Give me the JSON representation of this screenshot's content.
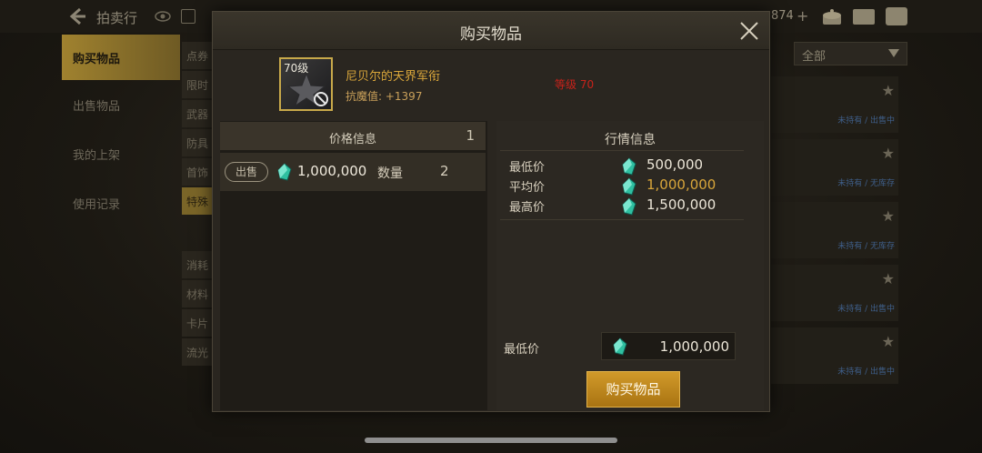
{
  "background": {
    "title": "拍卖行",
    "currency": "874",
    "nav_items": [
      "购买物品",
      "出售物品",
      "我的上架",
      "使用记录"
    ],
    "sub_nav_items": [
      "点券",
      "限时",
      "武器",
      "防具",
      "首饰",
      "特殊",
      "消耗",
      "材料",
      "卡片",
      "流光"
    ],
    "filter_value": "全部",
    "row_status": [
      "未持有 / 出售中",
      "未持有 / 无库存",
      "未持有 / 无库存",
      "未持有 / 出售中",
      "未持有 / 出售中",
      ""
    ]
  },
  "modal": {
    "title": "购买物品",
    "item": {
      "level_badge": "70级",
      "name": "尼贝尔的天界军衔",
      "stat": "抗魔值: +1397",
      "level_requirement": "等级 70",
      "icon": "star-rank-icon",
      "overlay_icon": "banned-icon"
    },
    "price_info": {
      "title": "价格信息",
      "count": "1",
      "listing": {
        "badge": "出售",
        "price": "1,000,000",
        "qty_label": "数量",
        "qty_value": "2"
      }
    },
    "market_info": {
      "title": "行情信息",
      "rows": [
        {
          "label": "最低价",
          "value": "500,000"
        },
        {
          "label": "平均价",
          "value": "1,000,000"
        },
        {
          "label": "最高价",
          "value": "1,500,000"
        }
      ]
    },
    "buy_form": {
      "min_price_label": "最低价",
      "min_price_value": "1,000,000",
      "buy_button": "购买物品"
    }
  },
  "colors": {
    "accent_gold": "#d9a63a",
    "level_red": "#c8221a",
    "button_gold": "#c68d22",
    "gem_teal": "#2fbfa0"
  }
}
